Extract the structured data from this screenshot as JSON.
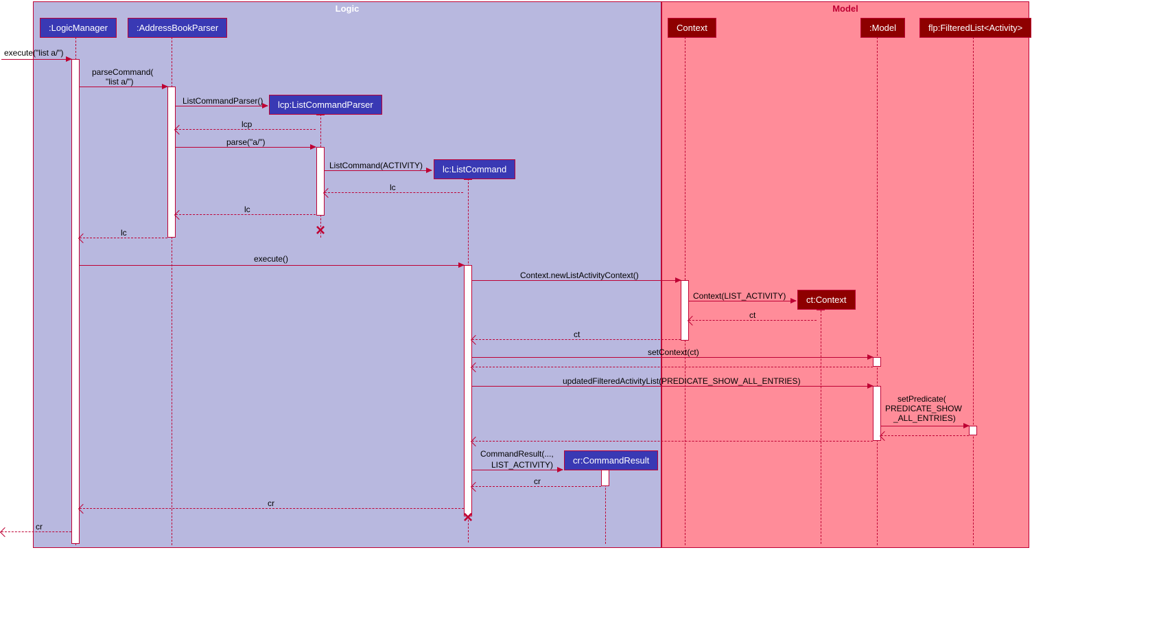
{
  "frames": {
    "logic": "Logic",
    "model": "Model"
  },
  "participants": {
    "logicManager": ":LogicManager",
    "addressBookParser": ":AddressBookParser",
    "listCommandParser": "lcp:ListCommandParser",
    "listCommand": "lc:ListCommand",
    "context": "Context",
    "ctContext": "ct:Context",
    "model": ":Model",
    "filteredList": "flp:FilteredList<Activity>",
    "commandResult": "cr:CommandResult"
  },
  "messages": {
    "m1": "execute(\"list a/\")",
    "m2": "parseCommand(",
    "m2b": "\"list a/\")",
    "m3": "ListCommandParser()",
    "r3": "lcp",
    "m4": "parse(\"a/\")",
    "m5": "ListCommand(ACTIVITY)",
    "r5": "lc",
    "r4": "lc",
    "r2": "lc",
    "m6": "execute()",
    "m7": "Context.newListActivityContext()",
    "m8": "Context(LIST_ACTIVITY)",
    "r8": "ct",
    "r7": "ct",
    "m9": "setContext(ct)",
    "m10": "updatedFilteredActivityList(PREDICATE_SHOW_ALL_ENTRIES)",
    "m11a": "setPredicate(",
    "m11b": "PREDICATE_SHOW",
    "m11c": "_ALL_ENTRIES)",
    "m12a": "CommandResult(...,",
    "m12b": "LIST_ACTIVITY)",
    "r12": "cr",
    "r6": "cr",
    "rfinal": "cr"
  }
}
